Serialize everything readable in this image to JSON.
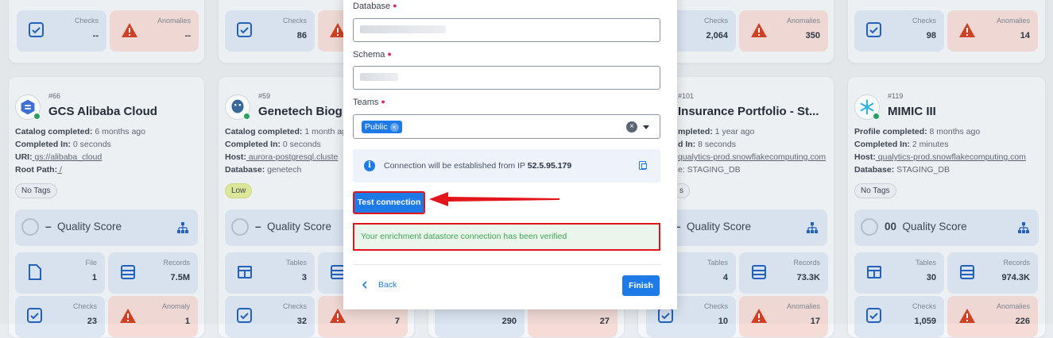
{
  "top_row": [
    {
      "checks_label": "Checks",
      "checks": "--",
      "anomalies_label": "Anomalies",
      "anomalies": "--"
    },
    {
      "checks_label": "Checks",
      "checks": "86",
      "anomalies_label": "",
      "anomalies": ""
    },
    {
      "checks_label": "Checks",
      "checks": "2,064",
      "anomalies_label": "Anomalies",
      "anomalies": "350"
    },
    {
      "checks_label": "Checks",
      "checks": "98",
      "anomalies_label": "Anomalies",
      "anomalies": "14"
    }
  ],
  "cards": [
    {
      "id": "#66",
      "name": "GCS Alibaba Cloud",
      "meta": [
        {
          "k": "Catalog completed:",
          "v": " 6 months ago"
        },
        {
          "k": "Completed In:",
          "v": " 0 seconds"
        },
        {
          "k": "URI:",
          "v": " gs://alibaba_cloud",
          "link": true
        },
        {
          "k": "Root Path:",
          "v": " /",
          "link": true
        }
      ],
      "tag": "No Tags",
      "quality_score": "–",
      "quality_label": "Quality Score",
      "tile1_label": "File",
      "tile1_val": "1",
      "tile2_label": "Records",
      "tile2_val": "7.5M",
      "tile3_label": "Checks",
      "tile3_val": "23",
      "tile4_label": "Anomaly",
      "tile4_val": "1"
    },
    {
      "id": "#59",
      "name": "Genetech Biog",
      "meta": [
        {
          "k": "Catalog completed:",
          "v": " 1 month ag"
        },
        {
          "k": "Completed In:",
          "v": " 0 seconds"
        },
        {
          "k": "Host:",
          "v": " aurora-postgresql.cluste",
          "link": true
        },
        {
          "k": "Database:",
          "v": " genetech"
        }
      ],
      "tag": "Low",
      "quality_score": "–",
      "quality_label": "Quality Score",
      "tile1_label": "Tables",
      "tile1_val": "3",
      "tile2_label": "",
      "tile2_val": "",
      "tile3_label": "Checks",
      "tile3_val": "32",
      "tile4_label": "",
      "tile4_val": "7"
    },
    {
      "id": "#101",
      "name": "Insurance Portfolio - St...",
      "meta": [
        {
          "k": "mpleted:",
          "v": " 1 year ago"
        },
        {
          "k": "d In:",
          "v": " 8 seconds"
        },
        {
          "k": "",
          "v": "qualytics-prod.snowflakecomputing.com",
          "link": true
        },
        {
          "k": "",
          "v": "e: STAGING_DB"
        }
      ],
      "tag": "s",
      "quality_score": "–",
      "quality_label": "Quality Score",
      "tile1_label": "Tables",
      "tile1_val": "4",
      "tile2_label": "Records",
      "tile2_val": "73.3K",
      "tile3_label": "Checks",
      "tile3_val": "10",
      "tile4_label": "Anomalies",
      "tile4_val": "17"
    },
    {
      "id": "#119",
      "name": "MIMIC III",
      "meta": [
        {
          "k": "Profile completed:",
          "v": " 8 months ago"
        },
        {
          "k": "Completed In:",
          "v": " 2 minutes"
        },
        {
          "k": "Host:",
          "v": " qualytics-prod.snowflakecomputing.com",
          "link": true
        },
        {
          "k": "Database:",
          "v": " STAGING_DB"
        }
      ],
      "tag": "No Tags",
      "quality_score": "00",
      "quality_label": "Quality Score",
      "tile1_label": "Tables",
      "tile1_val": "30",
      "tile2_label": "Records",
      "tile2_val": "974.3K",
      "tile3_label": "Checks",
      "tile3_val": "1,059",
      "tile4_label": "Anomalies",
      "tile4_val": "226"
    }
  ],
  "partial_card": {
    "tile1_val": "290",
    "tile2_val": "27"
  },
  "modal": {
    "database_label": "Database",
    "schema_label": "Schema",
    "teams_label": "Teams",
    "team_chip": "Public",
    "info_text": "Connection will be established from IP ",
    "info_ip": "52.5.95.179",
    "test_button": "Test connection",
    "success_message": "Your enrichment datastore connection has been verified",
    "back_label": "Back",
    "finish_label": "Finish"
  },
  "colors": {
    "primary": "#1e7ae6",
    "highlight": "#e4141b",
    "success_text": "#3fa356",
    "required": "#d6246e"
  }
}
